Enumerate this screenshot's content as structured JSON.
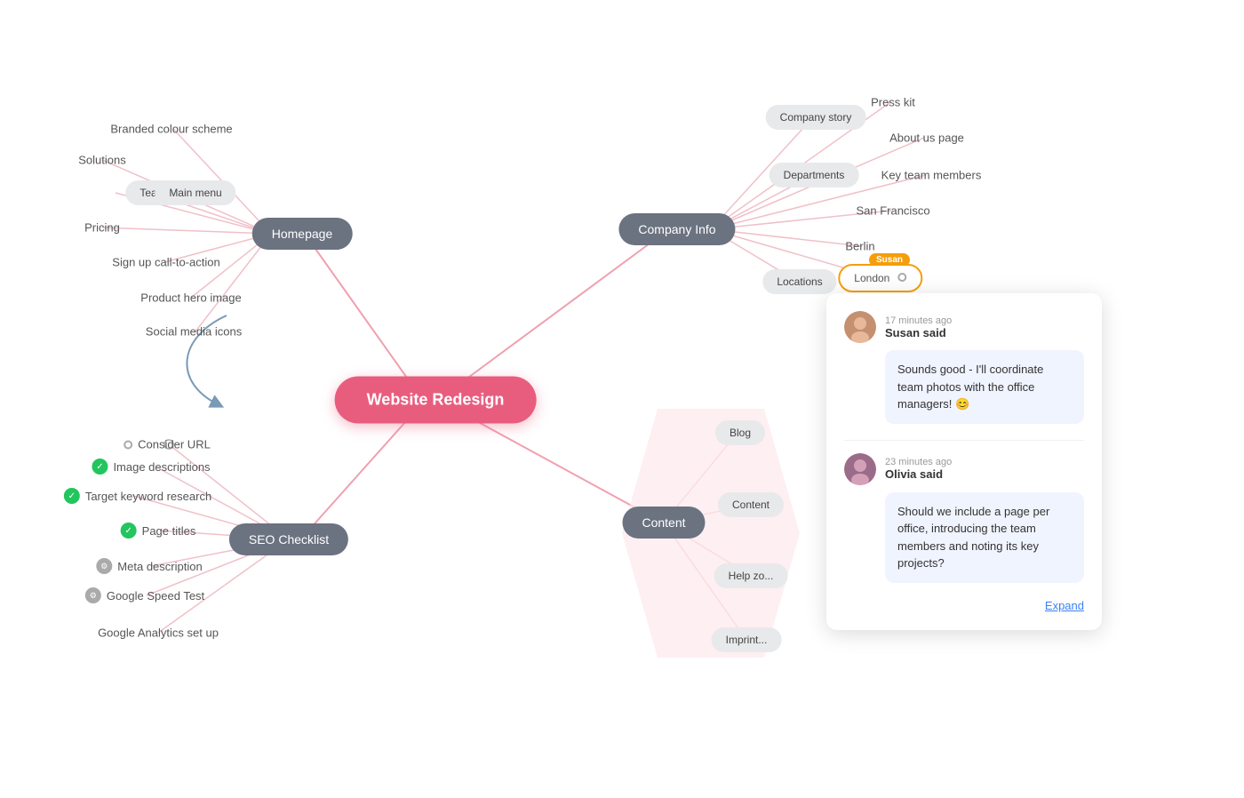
{
  "mindmap": {
    "title": "Website Redesign",
    "sections": {
      "homepage": {
        "label": "Homepage",
        "children": [
          {
            "text": "Branded colour scheme",
            "type": "text"
          },
          {
            "text": "Solutions",
            "type": "text"
          },
          {
            "text": "Teams",
            "type": "leaf"
          },
          {
            "text": "Main menu",
            "type": "leaf"
          },
          {
            "text": "Pricing",
            "type": "text"
          },
          {
            "text": "Sign up call-to-action",
            "type": "text"
          },
          {
            "text": "Product hero image",
            "type": "text"
          },
          {
            "text": "Social media icons",
            "type": "text"
          }
        ]
      },
      "company_info": {
        "label": "Company Info",
        "children": [
          {
            "text": "Company story",
            "type": "leaf"
          },
          {
            "text": "Press kit",
            "type": "text"
          },
          {
            "text": "About us page",
            "type": "text"
          },
          {
            "text": "Departments",
            "type": "leaf"
          },
          {
            "text": "Key team members",
            "type": "text"
          },
          {
            "text": "San Francisco",
            "type": "text"
          },
          {
            "text": "Locations",
            "type": "leaf"
          },
          {
            "text": "Berlin",
            "type": "text"
          },
          {
            "text": "London",
            "type": "london"
          }
        ]
      },
      "seo_checklist": {
        "label": "SEO Checklist",
        "children": [
          {
            "text": "Consider URL",
            "type": "circle"
          },
          {
            "text": "Image descriptions",
            "type": "checked"
          },
          {
            "text": "Target keyword research",
            "type": "checked"
          },
          {
            "text": "Page titles",
            "type": "checked"
          },
          {
            "text": "Meta description",
            "type": "gear"
          },
          {
            "text": "Google Speed Test",
            "type": "gear"
          },
          {
            "text": "Google Analytics set up",
            "type": "text"
          }
        ]
      },
      "content": {
        "label": "Content",
        "children": [
          {
            "text": "Blog",
            "type": "leaf"
          },
          {
            "text": "Content",
            "type": "leaf"
          },
          {
            "text": "Help zo...",
            "type": "leaf"
          },
          {
            "text": "Imprint...",
            "type": "leaf"
          }
        ]
      }
    }
  },
  "comments": {
    "comment1": {
      "time": "17 minutes ago",
      "author": "Susan said",
      "text": "Sounds good - I'll coordinate team photos with the office managers! 😊"
    },
    "comment2": {
      "time": "23 minutes ago",
      "author": "Olivia said",
      "text": "Should we include a page per office, introducing the team members and noting its key projects?"
    },
    "expand_label": "Expand"
  },
  "labels": {
    "susan": "Susan",
    "london": "London"
  }
}
